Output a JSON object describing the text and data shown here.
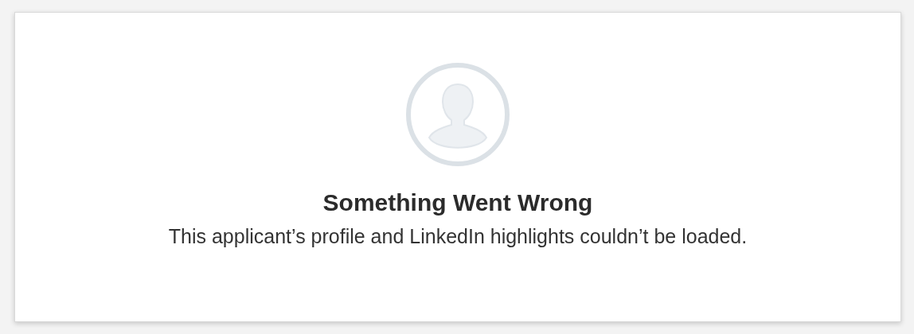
{
  "error": {
    "title": "Something Went Wrong",
    "message": "This applicant’s profile and LinkedIn highlights couldn’t be loaded."
  }
}
